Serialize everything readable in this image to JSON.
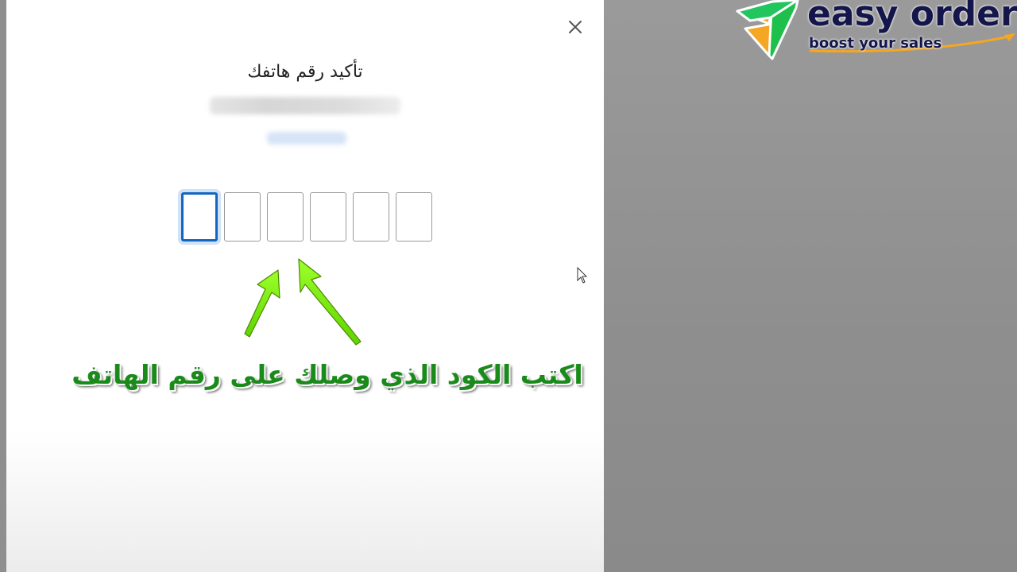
{
  "dialog": {
    "title": "تأكيد رقم هاتفك",
    "close_icon": "close-icon",
    "otp_digits": [
      "",
      "",
      "",
      "",
      "",
      ""
    ]
  },
  "overlay": {
    "instruction": "اكتب الكود الذي وصلك على رقم الهاتف",
    "arrow_color": "#7cfc00",
    "text_color": "#1a8a1a"
  },
  "logo": {
    "name": "easy orders",
    "tagline": "boost your sales",
    "green": "#22c55e",
    "orange": "#f5a623",
    "navy": "#14154a"
  },
  "colors": {
    "accent": "#1565c0",
    "backdrop": "#9a9a9a"
  }
}
